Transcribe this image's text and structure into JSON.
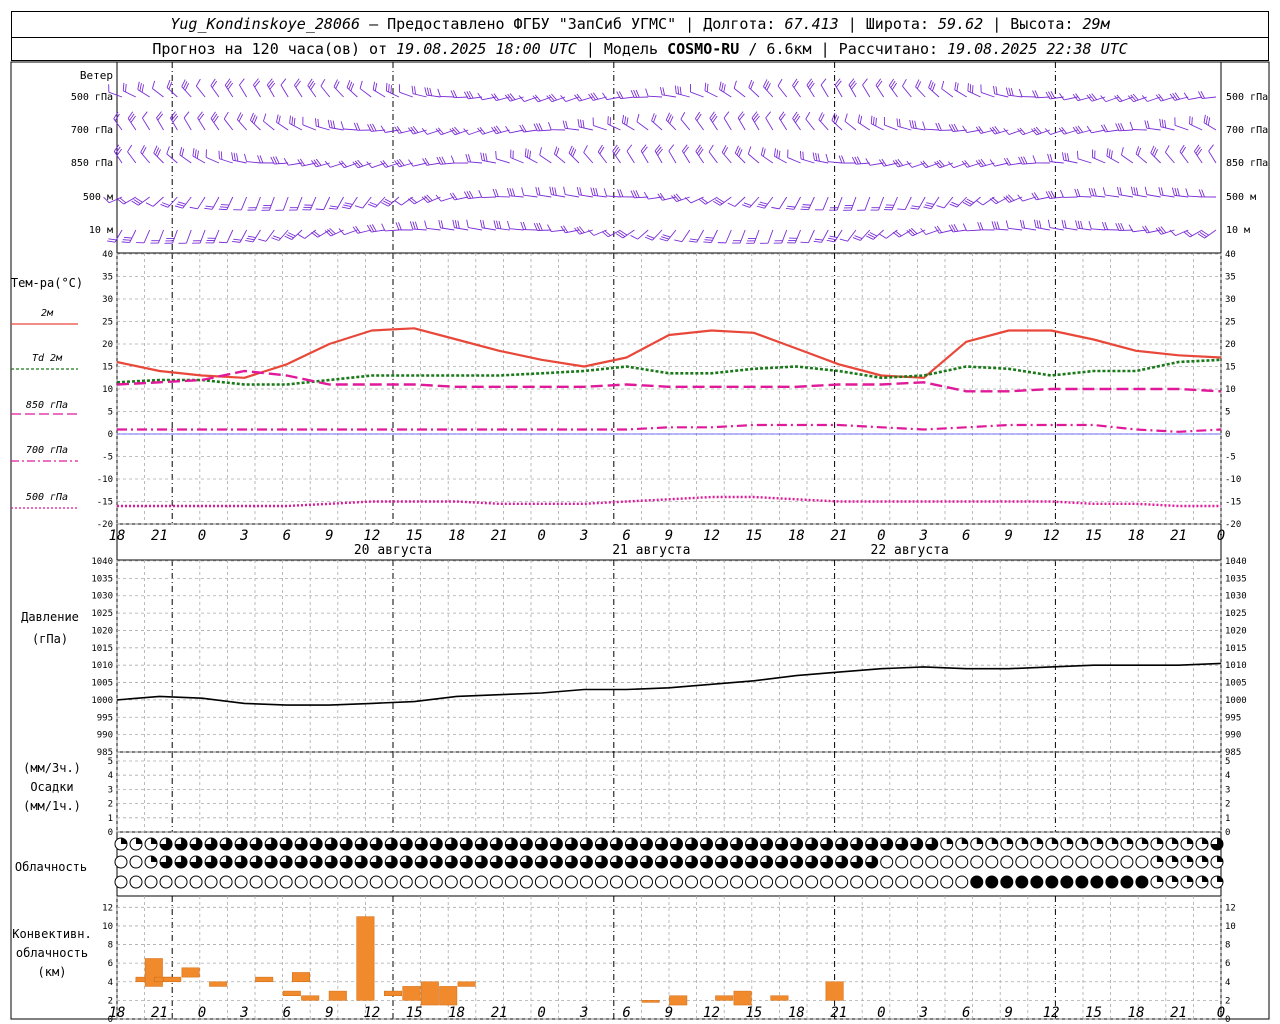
{
  "header": {
    "station": "Yug_Kondinskoye_28066",
    "provider": "– Предоставлено ФГБУ \"ЗапСиб УГМС\"",
    "lon_label": "| Долгота:",
    "lon": "67.413",
    "lat_label": "| Широта:",
    "lat": "59.62",
    "alt_label": "| Высота:",
    "alt": "29м",
    "forecast_label": "Прогноз на 120 часа(ов) от",
    "forecast_from": "19.08.2025 18:00 UTC",
    "model_label": "| Модель",
    "model": "COSMO-RU",
    "resolution": "/ 6.6км",
    "calc_label": "| Рассчитано:",
    "calc_time": "19.08.2025 22:38 UTC"
  },
  "panels": {
    "wind_title": "Ветер",
    "wind_levels": [
      "500 гПа",
      "700 гПа",
      "850 гПа",
      "500 м",
      "10 м"
    ],
    "temp_title": "Тем-ра(°С)",
    "temp_legend": [
      "2м",
      "Td  2м",
      "850 гПа",
      "700 гПа",
      "500 гПа"
    ],
    "pressure_title": "Давление",
    "pressure_unit": "(гПа)",
    "precip_labels": [
      "(мм/3ч.)",
      "Осадки",
      "(мм/1ч.)"
    ],
    "cloud_title": "Облачность",
    "conv_labels": [
      "Конвективн.",
      "облачность",
      "(км)"
    ]
  },
  "chart_data": {
    "type": "line",
    "x_hours_utc": [
      18,
      21,
      0,
      3,
      6,
      9,
      12,
      15,
      18,
      21,
      0,
      3,
      6,
      9,
      12,
      15,
      18,
      21,
      0,
      3,
      6,
      9,
      12,
      15,
      18,
      21,
      0
    ],
    "x_tick_labels": [
      "18",
      "21",
      "0",
      "3",
      "6",
      "9",
      "12",
      "15",
      "18",
      "21",
      "0",
      "3",
      "6",
      "9",
      "12",
      "15",
      "18",
      "21",
      "0",
      "3",
      "6",
      "9",
      "12",
      "15",
      "18",
      "21",
      "0"
    ],
    "day_labels": [
      "20 августа",
      "21 августа",
      "22 августа"
    ],
    "temperature": {
      "ylim": [
        -20,
        40
      ],
      "yticks": [
        -20,
        -15,
        -10,
        -5,
        0,
        5,
        10,
        15,
        20,
        25,
        30,
        35,
        40
      ],
      "series": [
        {
          "name": "2м",
          "color": "#e8483a",
          "values": [
            16,
            14,
            13,
            12.5,
            15.5,
            20,
            23,
            23.5,
            21,
            18.5,
            16.5,
            15,
            17,
            22,
            23,
            22.5,
            19,
            15.5,
            13,
            12.5,
            20.5,
            23,
            23,
            21,
            18.5,
            17.5,
            17
          ]
        },
        {
          "name": "Td  2м",
          "color": "#1a7a1a",
          "values": [
            11.5,
            12,
            12,
            11,
            11,
            12,
            13,
            13,
            13,
            13,
            13.5,
            14,
            15,
            13.5,
            13.5,
            14.5,
            15,
            14,
            12.5,
            13,
            15,
            14.5,
            13,
            14,
            14,
            16,
            16.5
          ]
        },
        {
          "name": "850 гПа",
          "color": "#e0189a",
          "values": [
            11,
            11.5,
            12,
            14,
            13,
            11,
            11,
            11,
            10.5,
            10.5,
            10.5,
            10.5,
            11,
            10.5,
            10.5,
            10.5,
            10.5,
            11,
            11,
            11.5,
            9.5,
            9.5,
            10,
            10,
            10,
            10,
            9.5
          ]
        },
        {
          "name": "700 гПа",
          "color": "#e0189a",
          "values": [
            1,
            1,
            1,
            1,
            1,
            1,
            1,
            1,
            1,
            1,
            1,
            1,
            1,
            1.5,
            1.5,
            2,
            2,
            2,
            1.5,
            1,
            1.5,
            2,
            2,
            2,
            1,
            0.5,
            1
          ]
        },
        {
          "name": "500 гПа",
          "color": "#e0189a",
          "values": [
            -16,
            -16,
            -16,
            -16,
            -16,
            -15.5,
            -15,
            -15,
            -15,
            -15.5,
            -15.5,
            -15.5,
            -15,
            -14.5,
            -14,
            -14,
            -14.5,
            -15,
            -15,
            -15,
            -15,
            -15,
            -15,
            -15.5,
            -15.5,
            -16,
            -16
          ]
        }
      ]
    },
    "pressure": {
      "ylim": [
        985,
        1040
      ],
      "yticks": [
        985,
        990,
        995,
        1000,
        1005,
        1010,
        1015,
        1020,
        1025,
        1030,
        1035,
        1040
      ],
      "series": [
        {
          "name": "",
          "color": "#000000",
          "values": [
            1000,
            1001,
            1000.5,
            999,
            998.5,
            998.5,
            999,
            999.5,
            1001,
            1001.5,
            1002,
            1003,
            1003,
            1003.5,
            1004.5,
            1005.5,
            1007,
            1008,
            1009,
            1009.5,
            1009,
            1009,
            1009.5,
            1010,
            1010,
            1010,
            1010.5
          ]
        }
      ]
    },
    "precip": {
      "ylim": [
        0,
        5
      ],
      "yticks": [
        0,
        1,
        2,
        3,
        4,
        5
      ],
      "values": []
    },
    "clouds": {
      "symbols_per_row": 74,
      "rows": [
        "LLLHHHHHHHHHHHHHHHHHHHHHHHHHHHHHHHHHHHHHHHHHHHHHHHHHHHHLLLLLLLLLLLLLLLLLLHHHHHHHHHHHH",
        "EELHHHHHHHHHHHHHHHHHHHHHHHHHHHHHHHHHHHHHHHHHHHHHHHHEEEEEEEEEEEEEEEEEELLLLLHHHHHHHHHHHH",
        "EEEEEEEEEEEEEEEEEEEEEEEEEEEEEEEEEEEEEEEEEEEEEEEEEEEEEEEEEFFFFFFFFFFFFLLLLLLLLLLLLLLLLL"
      ]
    },
    "convective": {
      "ylim": [
        0,
        13
      ],
      "yticks": [
        0,
        2,
        4,
        6,
        8,
        10,
        12
      ],
      "bars": [
        {
          "h": 3,
          "base": 4,
          "top": 4.5
        },
        {
          "h": 4,
          "base": 3.5,
          "top": 6.5
        },
        {
          "h": 5,
          "base": 4,
          "top": 4.5
        },
        {
          "h": 6,
          "base": 4,
          "top": 4.5
        },
        {
          "h": 8,
          "base": 4.5,
          "top": 5.5
        },
        {
          "h": 11,
          "base": 3.5,
          "top": 4
        },
        {
          "h": 16,
          "base": 4,
          "top": 4.5
        },
        {
          "h": 19,
          "base": 2.5,
          "top": 3
        },
        {
          "h": 20,
          "base": 4,
          "top": 5
        },
        {
          "h": 21,
          "base": 2,
          "top": 2.5
        },
        {
          "h": 24,
          "base": 2,
          "top": 3
        },
        {
          "h": 27,
          "base": 2,
          "top": 11
        },
        {
          "h": 30,
          "base": 2.5,
          "top": 3
        },
        {
          "h": 32,
          "base": 2,
          "top": 3.5
        },
        {
          "h": 34,
          "base": 1.5,
          "top": 4
        },
        {
          "h": 36,
          "base": 1.5,
          "top": 3.5
        },
        {
          "h": 38,
          "base": 3.5,
          "top": 4
        },
        {
          "h": 58,
          "base": 1.8,
          "top": 2
        },
        {
          "h": 61,
          "base": 1.5,
          "top": 2.5
        },
        {
          "h": 66,
          "base": 2,
          "top": 2.5
        },
        {
          "h": 68,
          "base": 1.5,
          "top": 3
        },
        {
          "h": 72,
          "base": 2,
          "top": 2.5
        },
        {
          "h": 78,
          "base": 2,
          "top": 4
        }
      ]
    }
  }
}
